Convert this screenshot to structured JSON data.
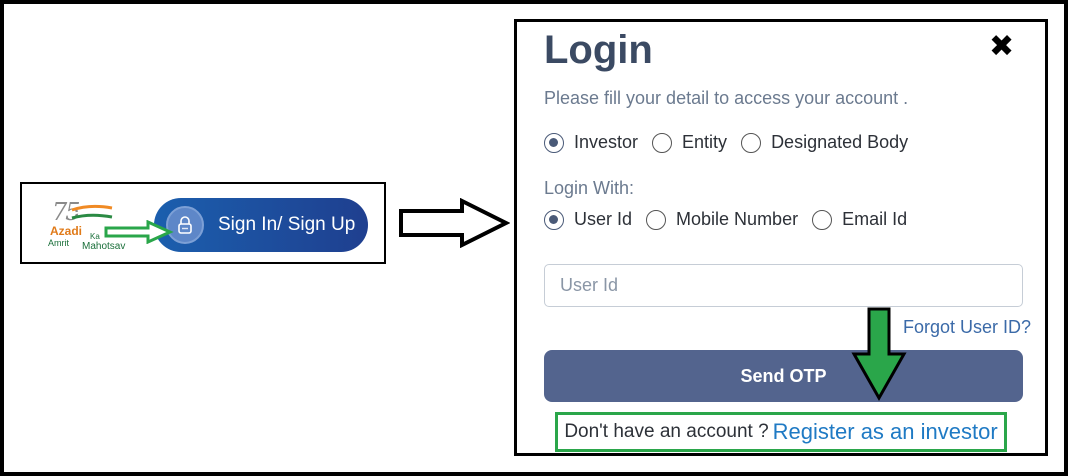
{
  "snippet": {
    "logo": {
      "line1": "75",
      "line2": "Azadi",
      "line3": "Ka",
      "line4": "Amrit",
      "line5": "Mahotsav"
    },
    "signin_label": "Sign In/ Sign Up"
  },
  "login": {
    "title": "Login",
    "close_icon": "close-icon",
    "subtitle": "Please fill your detail to access your account .",
    "account_types": [
      {
        "label": "Investor",
        "checked": true
      },
      {
        "label": "Entity",
        "checked": false
      },
      {
        "label": "Designated Body",
        "checked": false
      }
    ],
    "login_with_label": "Login With:",
    "login_methods": [
      {
        "label": "User Id",
        "checked": true
      },
      {
        "label": "Mobile Number",
        "checked": false
      },
      {
        "label": "Email Id",
        "checked": false
      }
    ],
    "userid_placeholder": "User Id",
    "forgot_label": "Forgot User ID?",
    "send_otp_label": "Send OTP",
    "no_account_text": "Don't have an account ?",
    "register_label": "Register as an investor"
  },
  "colors": {
    "highlight_green": "#2aa64a",
    "button_blue": "#53648e",
    "pill_blue": "#1b5fae",
    "link_blue": "#1f7ac4"
  }
}
